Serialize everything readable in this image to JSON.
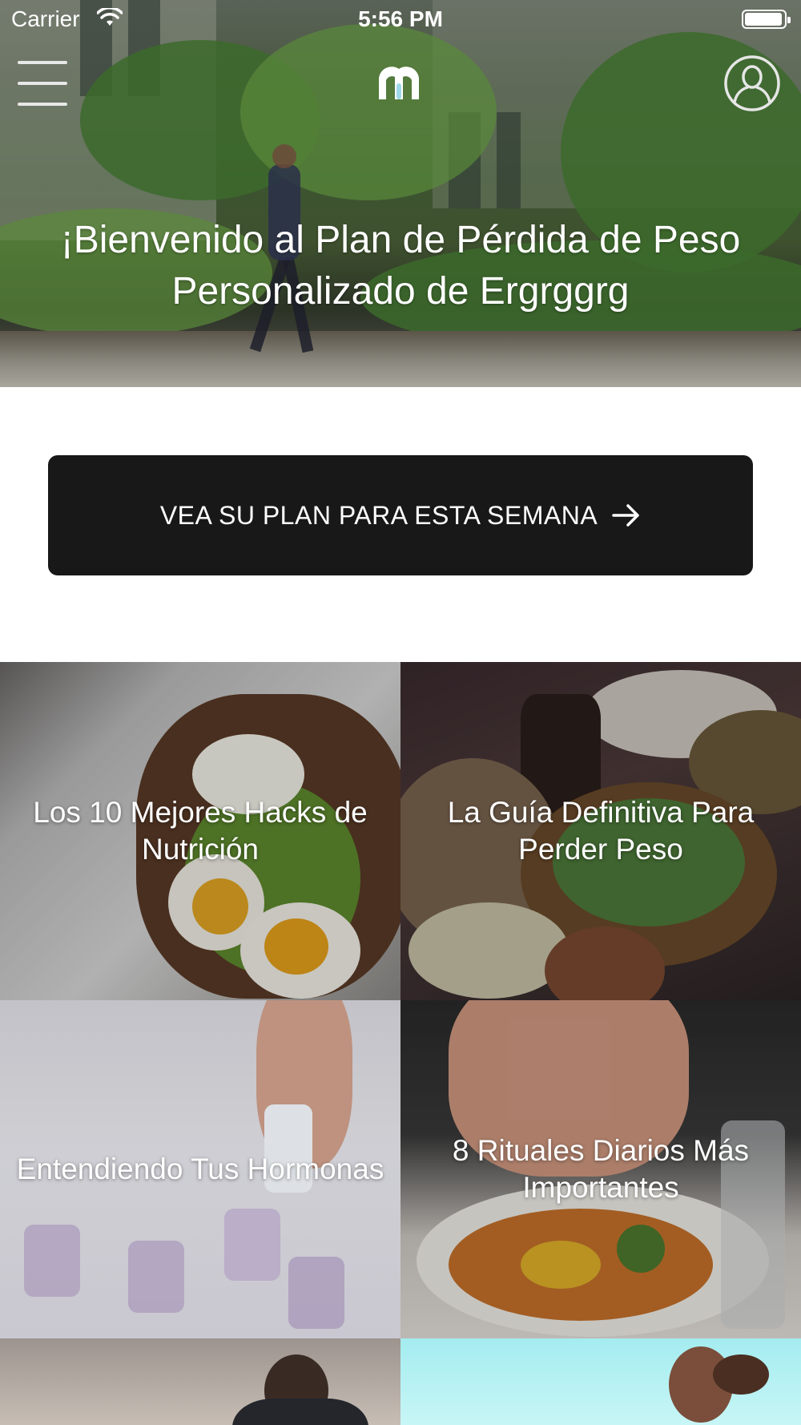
{
  "status_bar": {
    "carrier": "Carrier",
    "time": "5:56 PM",
    "battery_level": 0.95
  },
  "header": {
    "menu_icon": "hamburger-menu-icon",
    "logo_icon": "app-logo-m-icon",
    "profile_icon": "user-profile-icon"
  },
  "hero": {
    "title": "¡Bienvenido al Plan de Pérdida de Peso Personalizado de Ergrggrg"
  },
  "cta": {
    "label": "VEA SU PLAN PARA ESTA SEMANA",
    "icon": "arrow-right-icon"
  },
  "articles": [
    {
      "title": "Los 10 Mejores Hacks de Nutrición"
    },
    {
      "title": "La Guía Definitiva Para Perder Peso"
    },
    {
      "title": "Entendiendo Tus Hormonas"
    },
    {
      "title": "8 Rituales Diarios Más Importantes"
    },
    {
      "title": ""
    },
    {
      "title": ""
    }
  ],
  "colors": {
    "cta_background": "#181818",
    "logo_accent": "#9fd8e8",
    "text_on_image": "#ffffff"
  }
}
